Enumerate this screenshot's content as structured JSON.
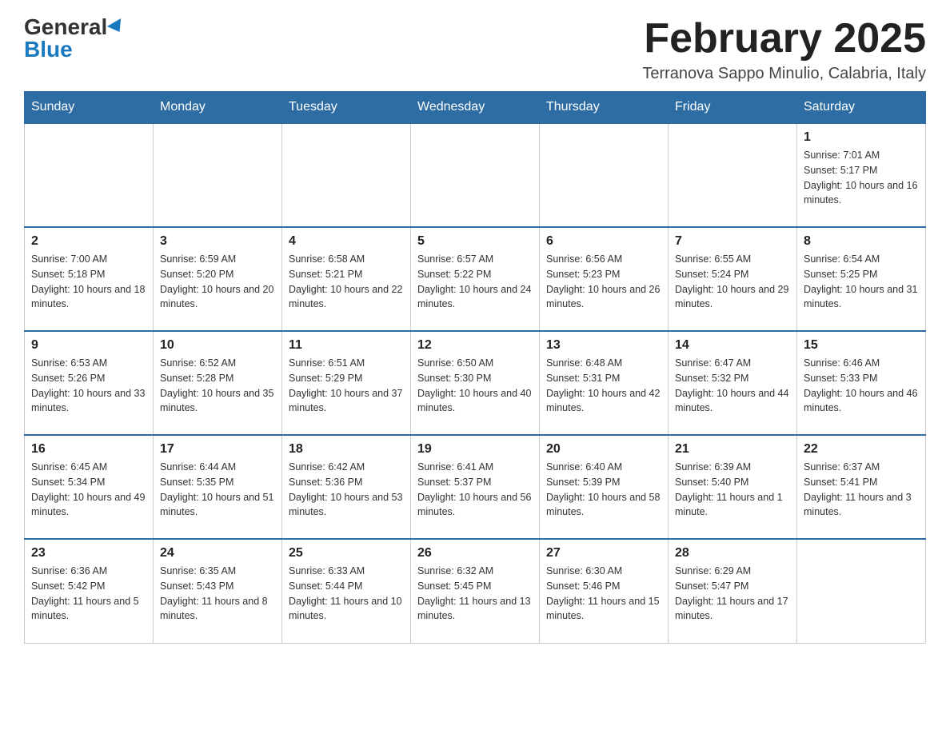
{
  "header": {
    "logo_general": "General",
    "logo_blue": "Blue",
    "month_title": "February 2025",
    "location": "Terranova Sappo Minulio, Calabria, Italy"
  },
  "weekdays": [
    "Sunday",
    "Monday",
    "Tuesday",
    "Wednesday",
    "Thursday",
    "Friday",
    "Saturday"
  ],
  "weeks": [
    [
      {
        "day": "",
        "info": ""
      },
      {
        "day": "",
        "info": ""
      },
      {
        "day": "",
        "info": ""
      },
      {
        "day": "",
        "info": ""
      },
      {
        "day": "",
        "info": ""
      },
      {
        "day": "",
        "info": ""
      },
      {
        "day": "1",
        "info": "Sunrise: 7:01 AM\nSunset: 5:17 PM\nDaylight: 10 hours and 16 minutes."
      }
    ],
    [
      {
        "day": "2",
        "info": "Sunrise: 7:00 AM\nSunset: 5:18 PM\nDaylight: 10 hours and 18 minutes."
      },
      {
        "day": "3",
        "info": "Sunrise: 6:59 AM\nSunset: 5:20 PM\nDaylight: 10 hours and 20 minutes."
      },
      {
        "day": "4",
        "info": "Sunrise: 6:58 AM\nSunset: 5:21 PM\nDaylight: 10 hours and 22 minutes."
      },
      {
        "day": "5",
        "info": "Sunrise: 6:57 AM\nSunset: 5:22 PM\nDaylight: 10 hours and 24 minutes."
      },
      {
        "day": "6",
        "info": "Sunrise: 6:56 AM\nSunset: 5:23 PM\nDaylight: 10 hours and 26 minutes."
      },
      {
        "day": "7",
        "info": "Sunrise: 6:55 AM\nSunset: 5:24 PM\nDaylight: 10 hours and 29 minutes."
      },
      {
        "day": "8",
        "info": "Sunrise: 6:54 AM\nSunset: 5:25 PM\nDaylight: 10 hours and 31 minutes."
      }
    ],
    [
      {
        "day": "9",
        "info": "Sunrise: 6:53 AM\nSunset: 5:26 PM\nDaylight: 10 hours and 33 minutes."
      },
      {
        "day": "10",
        "info": "Sunrise: 6:52 AM\nSunset: 5:28 PM\nDaylight: 10 hours and 35 minutes."
      },
      {
        "day": "11",
        "info": "Sunrise: 6:51 AM\nSunset: 5:29 PM\nDaylight: 10 hours and 37 minutes."
      },
      {
        "day": "12",
        "info": "Sunrise: 6:50 AM\nSunset: 5:30 PM\nDaylight: 10 hours and 40 minutes."
      },
      {
        "day": "13",
        "info": "Sunrise: 6:48 AM\nSunset: 5:31 PM\nDaylight: 10 hours and 42 minutes."
      },
      {
        "day": "14",
        "info": "Sunrise: 6:47 AM\nSunset: 5:32 PM\nDaylight: 10 hours and 44 minutes."
      },
      {
        "day": "15",
        "info": "Sunrise: 6:46 AM\nSunset: 5:33 PM\nDaylight: 10 hours and 46 minutes."
      }
    ],
    [
      {
        "day": "16",
        "info": "Sunrise: 6:45 AM\nSunset: 5:34 PM\nDaylight: 10 hours and 49 minutes."
      },
      {
        "day": "17",
        "info": "Sunrise: 6:44 AM\nSunset: 5:35 PM\nDaylight: 10 hours and 51 minutes."
      },
      {
        "day": "18",
        "info": "Sunrise: 6:42 AM\nSunset: 5:36 PM\nDaylight: 10 hours and 53 minutes."
      },
      {
        "day": "19",
        "info": "Sunrise: 6:41 AM\nSunset: 5:37 PM\nDaylight: 10 hours and 56 minutes."
      },
      {
        "day": "20",
        "info": "Sunrise: 6:40 AM\nSunset: 5:39 PM\nDaylight: 10 hours and 58 minutes."
      },
      {
        "day": "21",
        "info": "Sunrise: 6:39 AM\nSunset: 5:40 PM\nDaylight: 11 hours and 1 minute."
      },
      {
        "day": "22",
        "info": "Sunrise: 6:37 AM\nSunset: 5:41 PM\nDaylight: 11 hours and 3 minutes."
      }
    ],
    [
      {
        "day": "23",
        "info": "Sunrise: 6:36 AM\nSunset: 5:42 PM\nDaylight: 11 hours and 5 minutes."
      },
      {
        "day": "24",
        "info": "Sunrise: 6:35 AM\nSunset: 5:43 PM\nDaylight: 11 hours and 8 minutes."
      },
      {
        "day": "25",
        "info": "Sunrise: 6:33 AM\nSunset: 5:44 PM\nDaylight: 11 hours and 10 minutes."
      },
      {
        "day": "26",
        "info": "Sunrise: 6:32 AM\nSunset: 5:45 PM\nDaylight: 11 hours and 13 minutes."
      },
      {
        "day": "27",
        "info": "Sunrise: 6:30 AM\nSunset: 5:46 PM\nDaylight: 11 hours and 15 minutes."
      },
      {
        "day": "28",
        "info": "Sunrise: 6:29 AM\nSunset: 5:47 PM\nDaylight: 11 hours and 17 minutes."
      },
      {
        "day": "",
        "info": ""
      }
    ]
  ]
}
